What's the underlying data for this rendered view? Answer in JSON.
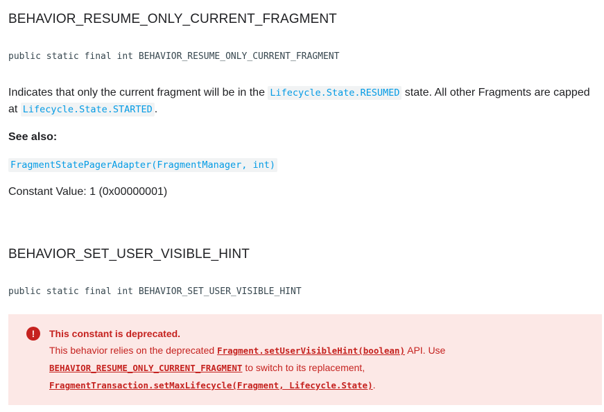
{
  "section1": {
    "title": "BEHAVIOR_RESUME_ONLY_CURRENT_FRAGMENT",
    "signature": "public static final int BEHAVIOR_RESUME_ONLY_CURRENT_FRAGMENT",
    "desc_part1": "Indicates that only the current fragment will be in the ",
    "desc_code1": "Lifecycle.State.RESUMED",
    "desc_part2": " state. All other Fragments are capped at ",
    "desc_code2": "Lifecycle.State.STARTED",
    "desc_part3": ".",
    "see_also_label": "See also:",
    "see_also_link": "FragmentStatePagerAdapter(FragmentManager, int)",
    "constant_value": "Constant Value: 1 (0x00000001)"
  },
  "section2": {
    "title": "BEHAVIOR_SET_USER_VISIBLE_HINT",
    "signature": "public static final int BEHAVIOR_SET_USER_VISIBLE_HINT",
    "caution": {
      "icon": "exclamation-circle-icon",
      "title": "This constant is deprecated.",
      "text1": "This behavior relies on the deprecated ",
      "link1": "Fragment.setUserVisibleHint(boolean)",
      "text2": " API. Use ",
      "link2": "BEHAVIOR_RESUME_ONLY_CURRENT_FRAGMENT",
      "text3": " to switch to its replacement, ",
      "link3": "FragmentTransaction.setMaxLifecycle(Fragment, Lifecycle.State)",
      "text4": "."
    }
  },
  "colors": {
    "link": "#039be5",
    "code_bg": "#f1f3f4",
    "caution_bg": "#fce8e6",
    "caution_text": "#c5221f"
  }
}
